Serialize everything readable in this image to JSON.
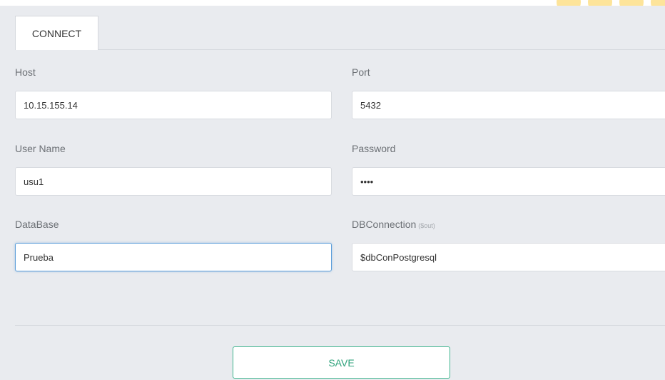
{
  "tabs": [
    {
      "label": "CONNECT"
    }
  ],
  "form": {
    "host": {
      "label": "Host",
      "value": "10.15.155.14"
    },
    "port": {
      "label": "Port",
      "value": "5432"
    },
    "user_name": {
      "label": "User Name",
      "value": "usu1"
    },
    "password": {
      "label": "Password",
      "value": "••••"
    },
    "database": {
      "label": "DataBase",
      "value": "Prueba"
    },
    "db_connection": {
      "label": "DBConnection",
      "sublabel": "($out)",
      "value": "$dbConPostgresql"
    }
  },
  "save_label": "SAVE",
  "colors": {
    "panel_bg": "#e9ebef",
    "save_accent": "#3fb58f",
    "focus_border": "#5b9dd9"
  }
}
